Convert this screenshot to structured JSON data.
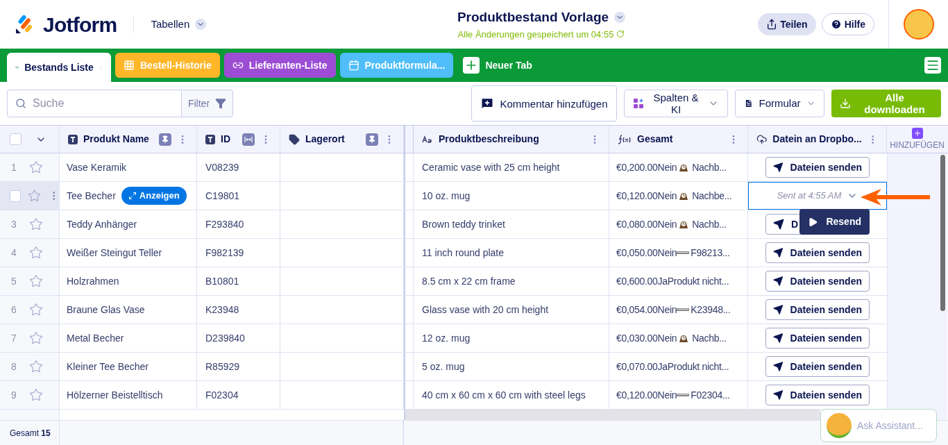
{
  "header": {
    "logo": "Jotform",
    "section": "Tabellen",
    "title": "Produktbestand Vorlage",
    "saved": "Alle Änderungen gespeichert um 04:55",
    "share": "Teilen",
    "help": "Hilfe"
  },
  "tabs": [
    {
      "label": "Bestands Liste",
      "selected": true,
      "color": "#ffffff",
      "kind": "link"
    },
    {
      "label": "Bestell-Historie",
      "selected": false,
      "color": "#ffb629",
      "kind": "grid"
    },
    {
      "label": "Lieferanten-Liste",
      "selected": false,
      "color": "#9c4dd3",
      "kind": "link"
    },
    {
      "label": "Produktformula...",
      "selected": false,
      "color": "#4fbef9",
      "kind": "calendar"
    }
  ],
  "new_tab": "Neuer Tab",
  "toolbar": {
    "search": {
      "placeholder": "Suche"
    },
    "filter": "Filter",
    "comment": "Kommentar hinzufügen",
    "columns": "Spalten & KI",
    "form": "Formular",
    "download": "Alle downloaden"
  },
  "select_all": {
    "checked": false
  },
  "columns": [
    {
      "label": "Produkt Name",
      "kind": "text",
      "pinned": true
    },
    {
      "label": "ID",
      "kind": "text",
      "pinned": false
    },
    {
      "label": "Lagerort",
      "kind": "tag",
      "pinned": true
    },
    {
      "label": "Produktbeschreibung",
      "kind": "longtext"
    },
    {
      "label": "Gesamt",
      "kind": "formula"
    },
    {
      "label": "Datein an Dropbo...",
      "kind": "upload"
    }
  ],
  "add_column": "HINZUFÜGEN",
  "rows": [
    {
      "number": "1",
      "hovered": false,
      "name": "Vase Keramik",
      "id": "V08239",
      "description": "Ceramic vase with 25 cm height",
      "total": {
        "value": "€0,200.00Nein",
        "kind": "clock",
        "rest": "Nachb..."
      },
      "dropbox": {
        "kind": "button",
        "label": "Dateien senden"
      }
    },
    {
      "hovered": true,
      "checked": false,
      "name": "Tee Becher",
      "open_button": "Anzeigen",
      "id": "C19801",
      "description": "10 oz. mug",
      "total": {
        "value": "€0,120.00Nein",
        "kind": "clock",
        "rest": "Nachbe..."
      },
      "dropbox": {
        "kind": "sent",
        "label": "Sent at 4:55 AM"
      }
    },
    {
      "number": "3",
      "hovered": false,
      "name": "Teddy Anhänger",
      "id": "F293840",
      "description": "Brown teddy trinket",
      "total": {
        "value": "€0,080.00Nein",
        "kind": "clock",
        "rest": "Nachb..."
      },
      "dropbox": {
        "kind": "button",
        "label": "D"
      }
    },
    {
      "number": "4",
      "hovered": false,
      "name": "Weißer Steingut Teller",
      "id": "F982139",
      "description": "11 inch round plate",
      "total": {
        "value": "€0,050.00Nein",
        "kind": "bar",
        "rest": "F98213..."
      },
      "dropbox": {
        "kind": "button",
        "label": "Dateien senden"
      }
    },
    {
      "number": "5",
      "hovered": false,
      "name": "Holzrahmen",
      "id": "B10801",
      "description": "8.5 cm x 22 cm frame",
      "total": {
        "value": "€0,600.00JaProdukt nicht..."
      },
      "dropbox": {
        "kind": "button",
        "label": "Dateien senden"
      }
    },
    {
      "number": "6",
      "hovered": false,
      "name": "Braune Glas Vase",
      "id": "K23948",
      "description": "Glass vase with 20 cm height",
      "total": {
        "value": "€0,054.00Nein",
        "kind": "bar",
        "rest": "K23948..."
      },
      "dropbox": {
        "kind": "button",
        "label": "Dateien senden"
      }
    },
    {
      "number": "7",
      "hovered": false,
      "name": "Metal Becher",
      "id": "D239840",
      "description": "12 oz. mug",
      "total": {
        "value": "€0,030.00Nein",
        "kind": "clock",
        "rest": "Nachb..."
      },
      "dropbox": {
        "kind": "button",
        "label": "Dateien senden"
      }
    },
    {
      "number": "8",
      "hovered": false,
      "name": "Kleiner Tee Becher",
      "id": "R85929",
      "description": "5 oz. mug",
      "total": {
        "value": "€0,070.00JaProdukt nicht..."
      },
      "dropbox": {
        "kind": "button",
        "label": "Dateien senden"
      }
    },
    {
      "number": "9",
      "hovered": false,
      "name": "Hölzerner Beistelltisch",
      "id": "F02304",
      "description": "40 cm x 60 cm x 60 cm with steel legs",
      "total": {
        "value": "€0,120.00Nein",
        "kind": "bar",
        "rest": "F02304..."
      },
      "dropbox": {
        "kind": "button",
        "label": "Dateien senden"
      }
    }
  ],
  "popup": {
    "label": "Resend"
  },
  "footer": {
    "total": "Gesamt **15**"
  },
  "assistant": {
    "placeholder": "Ask Assistant..."
  }
}
